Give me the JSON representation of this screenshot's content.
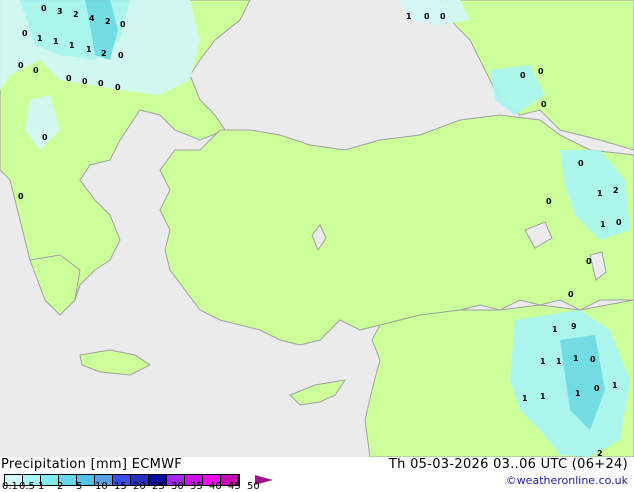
{
  "title": "Precipitation [mm]  ECMWF",
  "datetime": "Th 05-03-2026 03..06 UTC (06+24)",
  "credit": "©weatheronline.co.uk",
  "colors": {
    "sea": "#ebebeb",
    "land": "#ccff99",
    "border": "#a0a0a0"
  },
  "legend": {
    "ticks": [
      "0.1",
      "0.5",
      "1",
      "2",
      "5",
      "10",
      "15",
      "20",
      "25",
      "30",
      "35",
      "40",
      "45",
      "50"
    ],
    "colors": [
      "#d2f8f8",
      "#a8f5f5",
      "#80ecec",
      "#6ad8ea",
      "#55c0e8",
      "#5a9ee8",
      "#3c50e8",
      "#2830c0",
      "#0a0aa0",
      "#a028e8",
      "#c814e8",
      "#f00af0",
      "#c80ab4",
      "#a0148c"
    ]
  },
  "point_values": [
    "0",
    "3",
    "2",
    "4",
    "2",
    "0",
    "0",
    "1",
    "1",
    "1",
    "1",
    "2",
    "0",
    "0",
    "0",
    "0",
    "0",
    "0",
    "0",
    "0",
    "0",
    "1",
    "0",
    "0",
    "0",
    "0",
    "0",
    "1",
    "2",
    "1",
    "0",
    "0",
    "0",
    "0",
    "0",
    "1",
    "9",
    "1",
    "1",
    "1",
    "0",
    "1",
    "1",
    "1",
    "0",
    "1",
    "2"
  ]
}
